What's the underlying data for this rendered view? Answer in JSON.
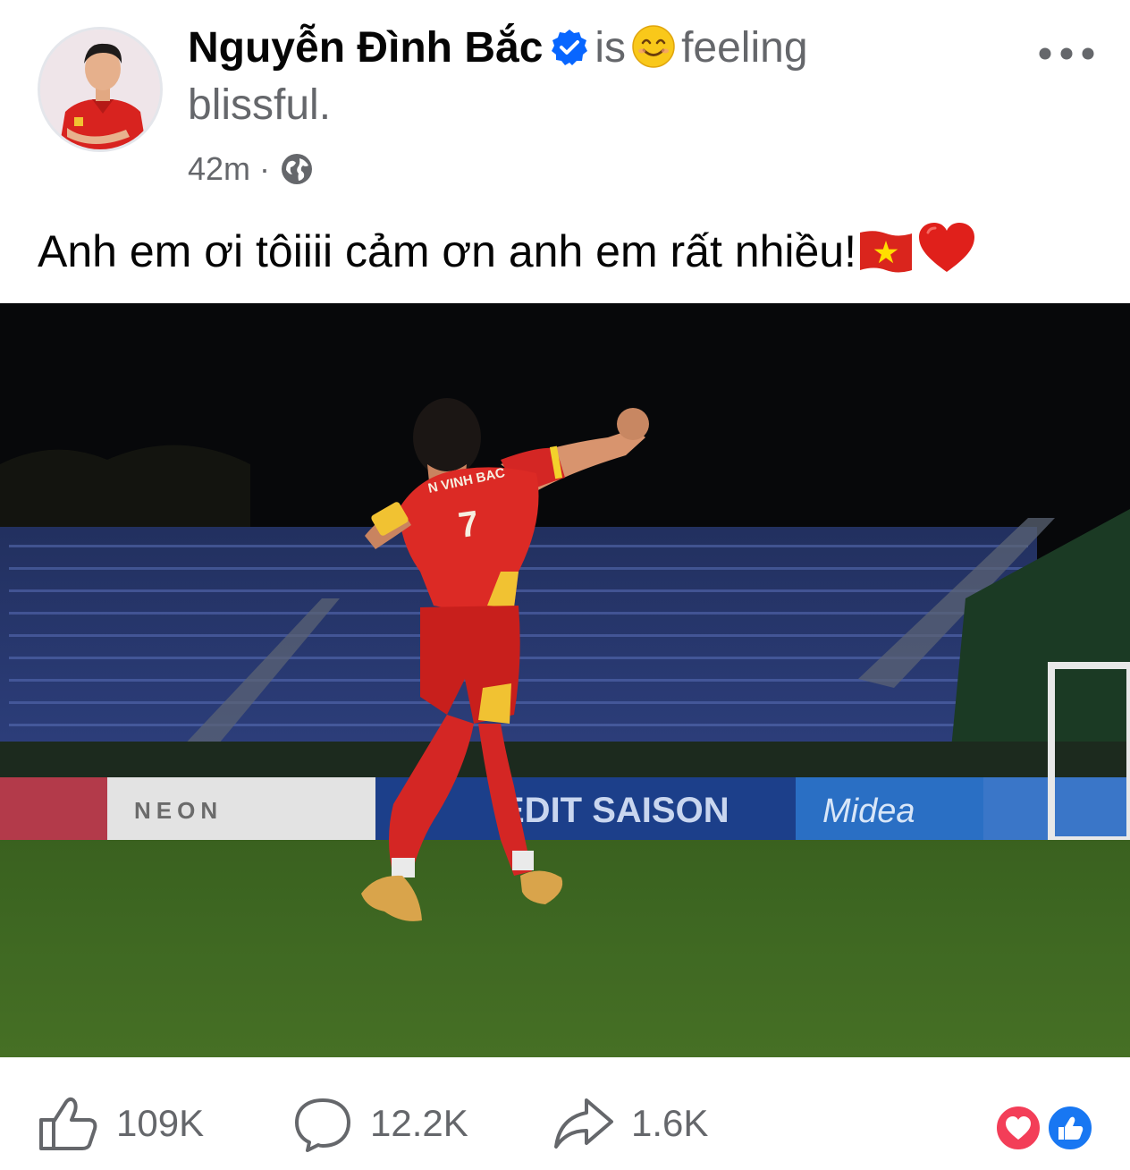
{
  "post": {
    "author": "Nguyễn Đình Bắc",
    "verb": "is",
    "feeling_word": "feeling",
    "feeling": "blissful.",
    "timestamp": "42m",
    "separator": "·",
    "audience_icon": "globe-icon",
    "text": "Anh em ơi tôiiii cảm ơn anh em rất nhiều!",
    "text_emojis": [
      "vietnam-flag",
      "red-heart"
    ]
  },
  "photo": {
    "jersey_name": "N VINH BAC",
    "jersey_number": "7",
    "boards": [
      "NEON",
      "EDIT SAISON",
      "Midea"
    ]
  },
  "actions": {
    "like_count": "109K",
    "comment_count": "12.2K",
    "share_count": "1.6K"
  },
  "colors": {
    "name": "#050505",
    "secondary": "#65676b",
    "verified": "#0866ff",
    "love": "#f33e58",
    "like": "#1877f2"
  }
}
